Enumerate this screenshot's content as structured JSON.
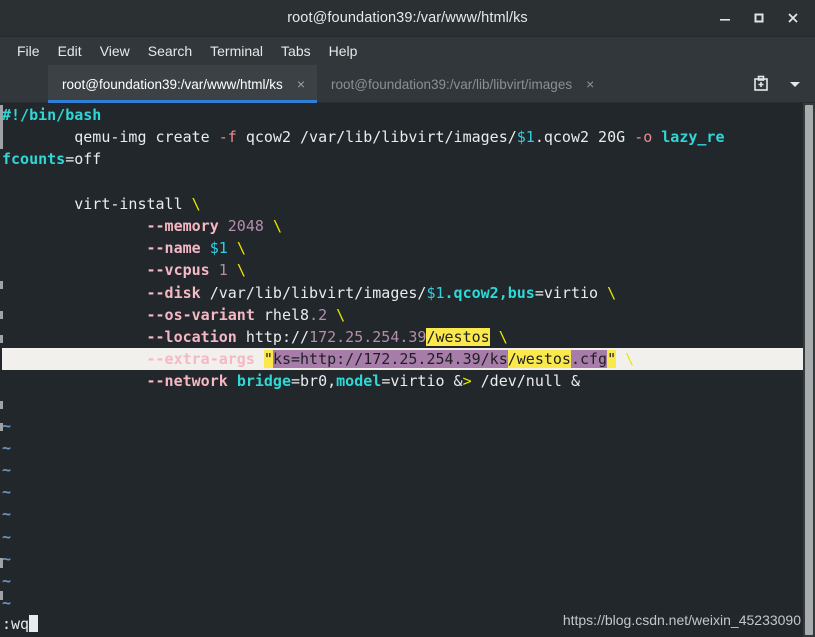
{
  "window": {
    "title": "root@foundation39:/var/www/html/ks",
    "controls": [
      {
        "name": "minimize",
        "glyph": "minimize-icon"
      },
      {
        "name": "maximize",
        "glyph": "maximize-icon"
      },
      {
        "name": "close",
        "glyph": "close-icon"
      }
    ]
  },
  "menubar": {
    "items": [
      "File",
      "Edit",
      "View",
      "Search",
      "Terminal",
      "Tabs",
      "Help"
    ]
  },
  "tabs": {
    "items": [
      {
        "label": "root@foundation39:/var/www/html/ks",
        "active": true,
        "close": "×"
      },
      {
        "label": "root@foundation39:/var/lib/libvirt/images",
        "active": false,
        "close": "×"
      }
    ],
    "new_tab_icon": "new-tab-icon",
    "tab_menu_icon": "chevron-down-icon"
  },
  "terminal": {
    "lines": [
      {
        "id": "l1",
        "text": "#!/bin/bash"
      },
      {
        "id": "l2",
        "text": "        qemu-img create -f qcow2 /var/lib/libvirt/images/$1.qcow2 20G -o lazy_re"
      },
      {
        "id": "l3",
        "text": "fcounts=off"
      },
      {
        "id": "l4",
        "text": ""
      },
      {
        "id": "l5",
        "text": "        virt-install \\"
      },
      {
        "id": "l6",
        "text": "                --memory 2048 \\"
      },
      {
        "id": "l7",
        "text": "                --name $1 \\"
      },
      {
        "id": "l8",
        "text": "                --vcpus 1 \\"
      },
      {
        "id": "l9",
        "text": "                --disk /var/lib/libvirt/images/$1.qcow2,bus=virtio \\"
      },
      {
        "id": "l10",
        "text": "                --os-variant rhel8.2 \\"
      },
      {
        "id": "l11",
        "text": "                --location http://172.25.254.39/westos \\"
      },
      {
        "id": "l12",
        "text": "                --extra-args \"ks=http://172.25.254.39/ks/westos.cfg\" \\"
      },
      {
        "id": "l13",
        "text": "                --network bridge=br0,model=virtio &> /dev/null &"
      },
      {
        "id": "l14",
        "text": ""
      },
      {
        "id": "l15",
        "text": "~"
      },
      {
        "id": "l16",
        "text": "~"
      },
      {
        "id": "l17",
        "text": "~"
      },
      {
        "id": "l18",
        "text": "~"
      },
      {
        "id": "l19",
        "text": "~"
      },
      {
        "id": "l20",
        "text": "~"
      },
      {
        "id": "l21",
        "text": "~"
      },
      {
        "id": "l22",
        "text": "~"
      },
      {
        "id": "l23",
        "text": "~"
      }
    ],
    "tokens": {
      "shebang": "#!/bin/bash",
      "indent8": "        ",
      "indent16": "                ",
      "qemu_cmd": "qemu-img create ",
      "opt_f": "-f",
      "qcow2_path": " qcow2 /var/lib/libvirt/images/",
      "var1": "$1",
      "qcow2_size": ".qcow2 20G ",
      "opt_o": "-o",
      "space": " ",
      "lazy_re": "lazy_re",
      "fcounts": "fcounts",
      "eq_off": "=off",
      "virt_install": "virt-install",
      "backslash": "\\",
      "opt_memory": "--memory",
      "val_2048": "2048",
      "opt_name": "--name",
      "opt_vcpus": "--vcpus",
      "val_1": "1",
      "opt_disk": "--disk",
      "disk_path": " /var/lib/libvirt/images/",
      "disk_suffix": ".qcow2,bus",
      "eq_virtio": "=virtio",
      "opt_os_variant": "--os-variant",
      "rhel8": " rhel8",
      "dot2": ".2",
      "opt_location": "--location",
      "http_prefix": " http://",
      "ip_addr": "172.25.254.39",
      "westos": "/westos",
      "opt_extra_args": "--extra-args",
      "quote": "\"",
      "ks_arg": "ks=http://172.25.254.39/ks",
      "westos2": "/westos",
      "cfg": ".cfg",
      "opt_network": "--network",
      "bridge": "bridge",
      "eq_br0": "=br0,",
      "model": "model",
      "amp": " &",
      "gt": ">",
      "devnull": " /dev/null &",
      "tilde": "~"
    },
    "status": ":wq",
    "watermark": "https://blog.csdn.net/weixin_45233090"
  },
  "colors": {
    "terminal_bg": "#22272b",
    "chrome_bg": "#2b3033",
    "menubar_bg": "#31373a",
    "accent_tab": "#2f7fd6",
    "cyan": "#2fd7d7",
    "pink": "#f5b8c4",
    "purple": "#b48ead",
    "yellow": "#e8e800",
    "highlight_yellow": "#fbe94b",
    "highlight_purple": "#a87ca8",
    "highlight_line": "#f2f0ec",
    "tilde_blue": "#6d96c4"
  }
}
